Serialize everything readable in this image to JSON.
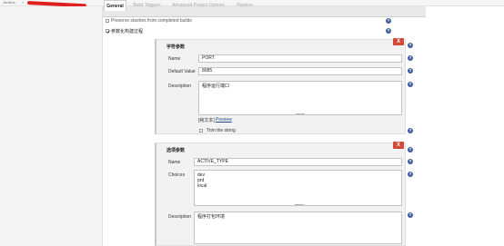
{
  "breadcrumb": {
    "root": "Jenkins",
    "separator": "»"
  },
  "tabs": [
    {
      "label": "General"
    },
    {
      "label": "Build Triggers"
    },
    {
      "label": "Advanced Project Options"
    },
    {
      "label": "Pipeline"
    }
  ],
  "options": {
    "discard_builds": "Preserve stashes from completed builds",
    "parameterized": "参数化构建过程"
  },
  "params": [
    {
      "title": "字符参数",
      "name_label": "Name",
      "name_value": "PORT",
      "default_label": "Default Value",
      "default_value": "8085",
      "desc_label": "Description",
      "desc_value": "程序运行端口",
      "text_mode": "[纯文本]",
      "preview_label": "Preview",
      "trim_label": "Trim the string"
    },
    {
      "title": "选项参数",
      "name_label": "Name",
      "name_value": "ACTIVE_TYPE",
      "choices_label": "Choices",
      "choices_value": "dev\nprd\nlocal",
      "desc_label": "Description",
      "desc_value": "程序打包环境"
    }
  ],
  "delete_label": "X",
  "help_glyph": "?",
  "colors": {
    "accent": "#3f5f9e",
    "delete": "#d24939",
    "redaction": "#e02020"
  }
}
